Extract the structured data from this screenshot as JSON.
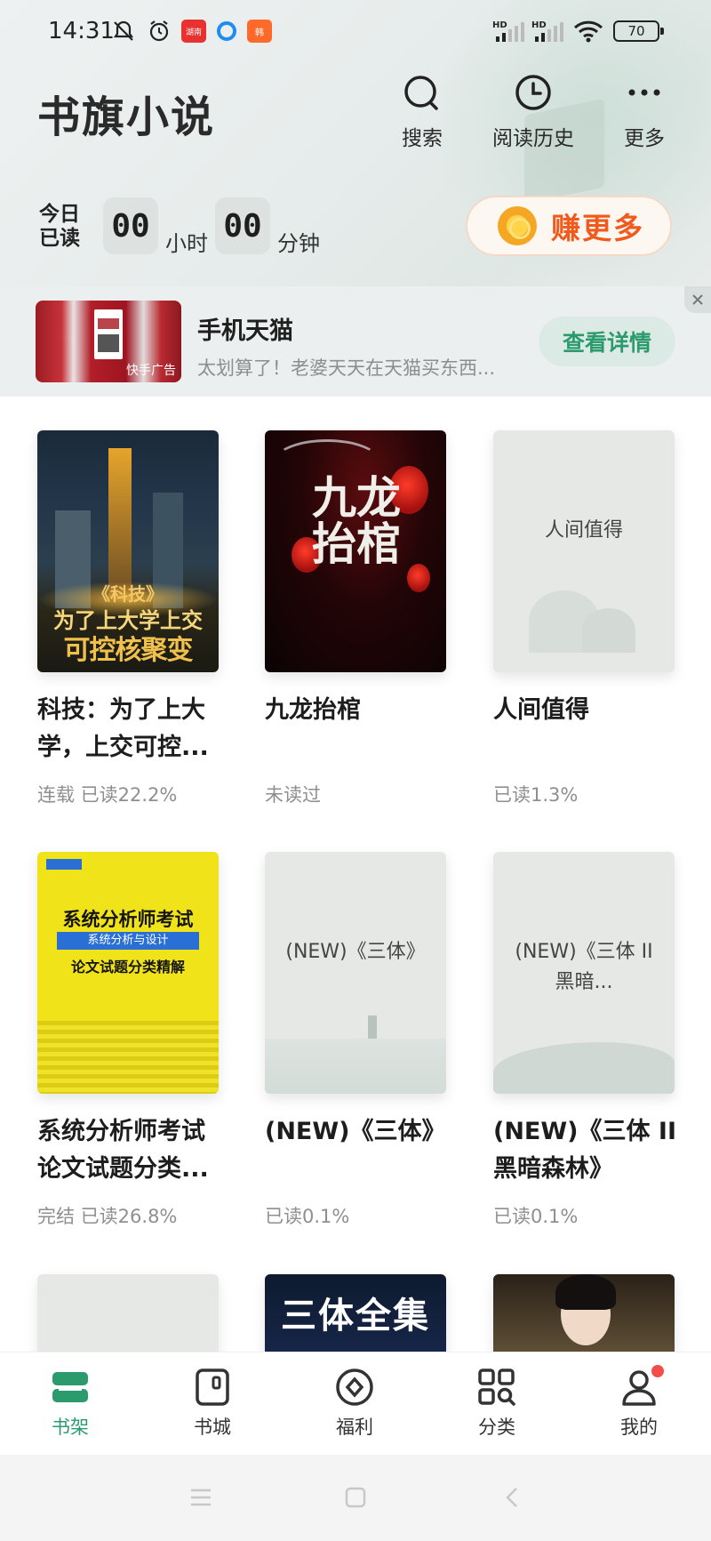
{
  "status_bar": {
    "time": "14:31",
    "app_badge_1": "湖南",
    "app_badge_3": "韩",
    "signal_1_label": "HD",
    "signal_2_label": "HD",
    "battery": "70"
  },
  "header": {
    "app_title": "书旗小说",
    "actions": [
      {
        "label": "搜索",
        "icon": "search-icon"
      },
      {
        "label": "阅读历史",
        "icon": "clock-icon"
      },
      {
        "label": "更多",
        "icon": "more-dots-icon"
      }
    ]
  },
  "reading_time": {
    "label": "今日已读",
    "hours": "00",
    "hours_unit": "小时",
    "minutes": "00",
    "minutes_unit": "分钟"
  },
  "earn_more": {
    "label": "赚更多",
    "icon": "coin-icon"
  },
  "ad": {
    "title": "手机天猫",
    "description": "太划算了！老婆天天在天猫买东西...",
    "source": "快手广告",
    "cta": "查看详情",
    "close": "×"
  },
  "books": [
    {
      "title": "科技：为了上大学，上交可控...",
      "status": "连载  已读22.2%",
      "cover_text": [
        "《科技》",
        "为了上大学上交",
        "可控核聚变"
      ]
    },
    {
      "title": "九龙抬棺",
      "status": "未读过",
      "cover_text": [
        "九龙抬棺"
      ]
    },
    {
      "title": "人间值得",
      "status": "已读1.3%",
      "cover_text": [
        "人间值得"
      ]
    },
    {
      "title": "系统分析师考试论文试题分类...",
      "status": "完结  已读26.8%",
      "cover_text": [
        "系统分析师考试",
        "系统分析与设计",
        "论文试题分类精解"
      ]
    },
    {
      "title": "(NEW)《三体》",
      "status": "已读0.1%",
      "cover_text": [
        "(NEW)《三体》"
      ]
    },
    {
      "title": "(NEW)《三体 II 黑暗森林》",
      "status": "已读0.1%",
      "cover_text": [
        "(NEW)《三体 II 黑暗..."
      ]
    },
    {
      "title": "",
      "status": "",
      "cover_text": [
        ""
      ]
    },
    {
      "title": "",
      "status": "",
      "cover_text": [
        "三体全集"
      ]
    },
    {
      "title": "",
      "status": "",
      "cover_text": [
        ""
      ]
    }
  ],
  "bottom_nav": [
    {
      "label": "书架",
      "icon": "bookshelf-icon",
      "active": true
    },
    {
      "label": "书城",
      "icon": "bookstore-icon",
      "active": false
    },
    {
      "label": "福利",
      "icon": "welfare-icon",
      "active": false
    },
    {
      "label": "分类",
      "icon": "category-icon",
      "active": false
    },
    {
      "label": "我的",
      "icon": "profile-icon",
      "active": false
    }
  ],
  "colors": {
    "accent": "#2b9b6e",
    "earn_text": "#f05a1c",
    "badge": "#f44b4b"
  }
}
